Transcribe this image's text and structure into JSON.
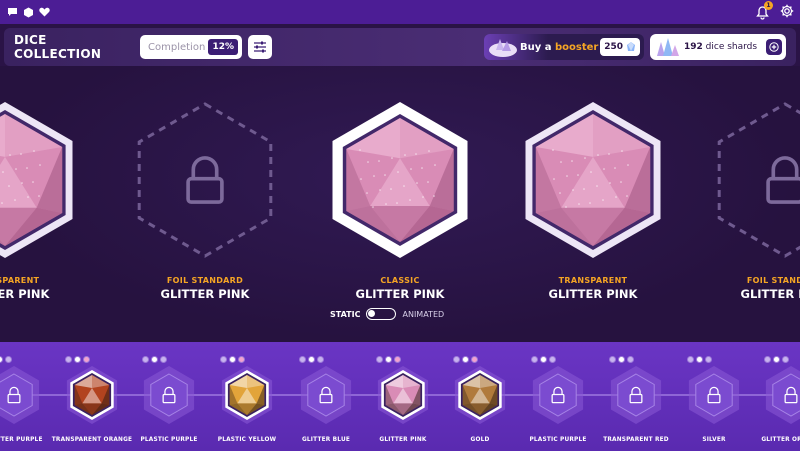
{
  "header": {
    "title": "DICE COLLECTION",
    "completion_label": "Completion",
    "completion_value": "12%",
    "booster_prefix": "Buy a",
    "booster_highlight": "booster",
    "booster_price": "250",
    "shards_count": "192",
    "shards_label": "dice shards"
  },
  "featured": [
    {
      "category": "TRANSPARENT",
      "name": "GLITTER PINK",
      "locked": false
    },
    {
      "category": "FOIL STANDARD",
      "name": "GLITTER PINK",
      "locked": true
    },
    {
      "category": "CLASSIC",
      "name": "GLITTER PINK",
      "locked": false,
      "selected": true
    },
    {
      "category": "TRANSPARENT",
      "name": "GLITTER PINK",
      "locked": false
    },
    {
      "category": "FOIL STANDARD",
      "name": "GLITTER PINK",
      "locked": true
    }
  ],
  "toggle": {
    "static_label": "STATIC",
    "animated_label": "ANIMATED",
    "state": "static"
  },
  "tray": [
    {
      "label": "GLITTER PURPLE",
      "locked": true
    },
    {
      "label": "TRANSPARENT ORANGE",
      "locked": false,
      "color": "#b2431f"
    },
    {
      "label": "PLASTIC PURPLE",
      "locked": true
    },
    {
      "label": "PLASTIC YELLOW",
      "locked": false,
      "color": "#e2a43a"
    },
    {
      "label": "GLITTER BLUE",
      "locked": true
    },
    {
      "label": "GLITTER PINK",
      "locked": false,
      "color": "#d98cb6"
    },
    {
      "label": "GOLD",
      "locked": false,
      "color": "#b07a3c"
    },
    {
      "label": "PLASTIC PURPLE",
      "locked": true
    },
    {
      "label": "TRANSPARENT RED",
      "locked": true
    },
    {
      "label": "SILVER",
      "locked": true
    },
    {
      "label": "GLITTER ORANGE",
      "locked": true
    }
  ],
  "colors": {
    "accent": "#f5a524",
    "brand": "#4c1d95",
    "tray": "#6a35c4"
  }
}
